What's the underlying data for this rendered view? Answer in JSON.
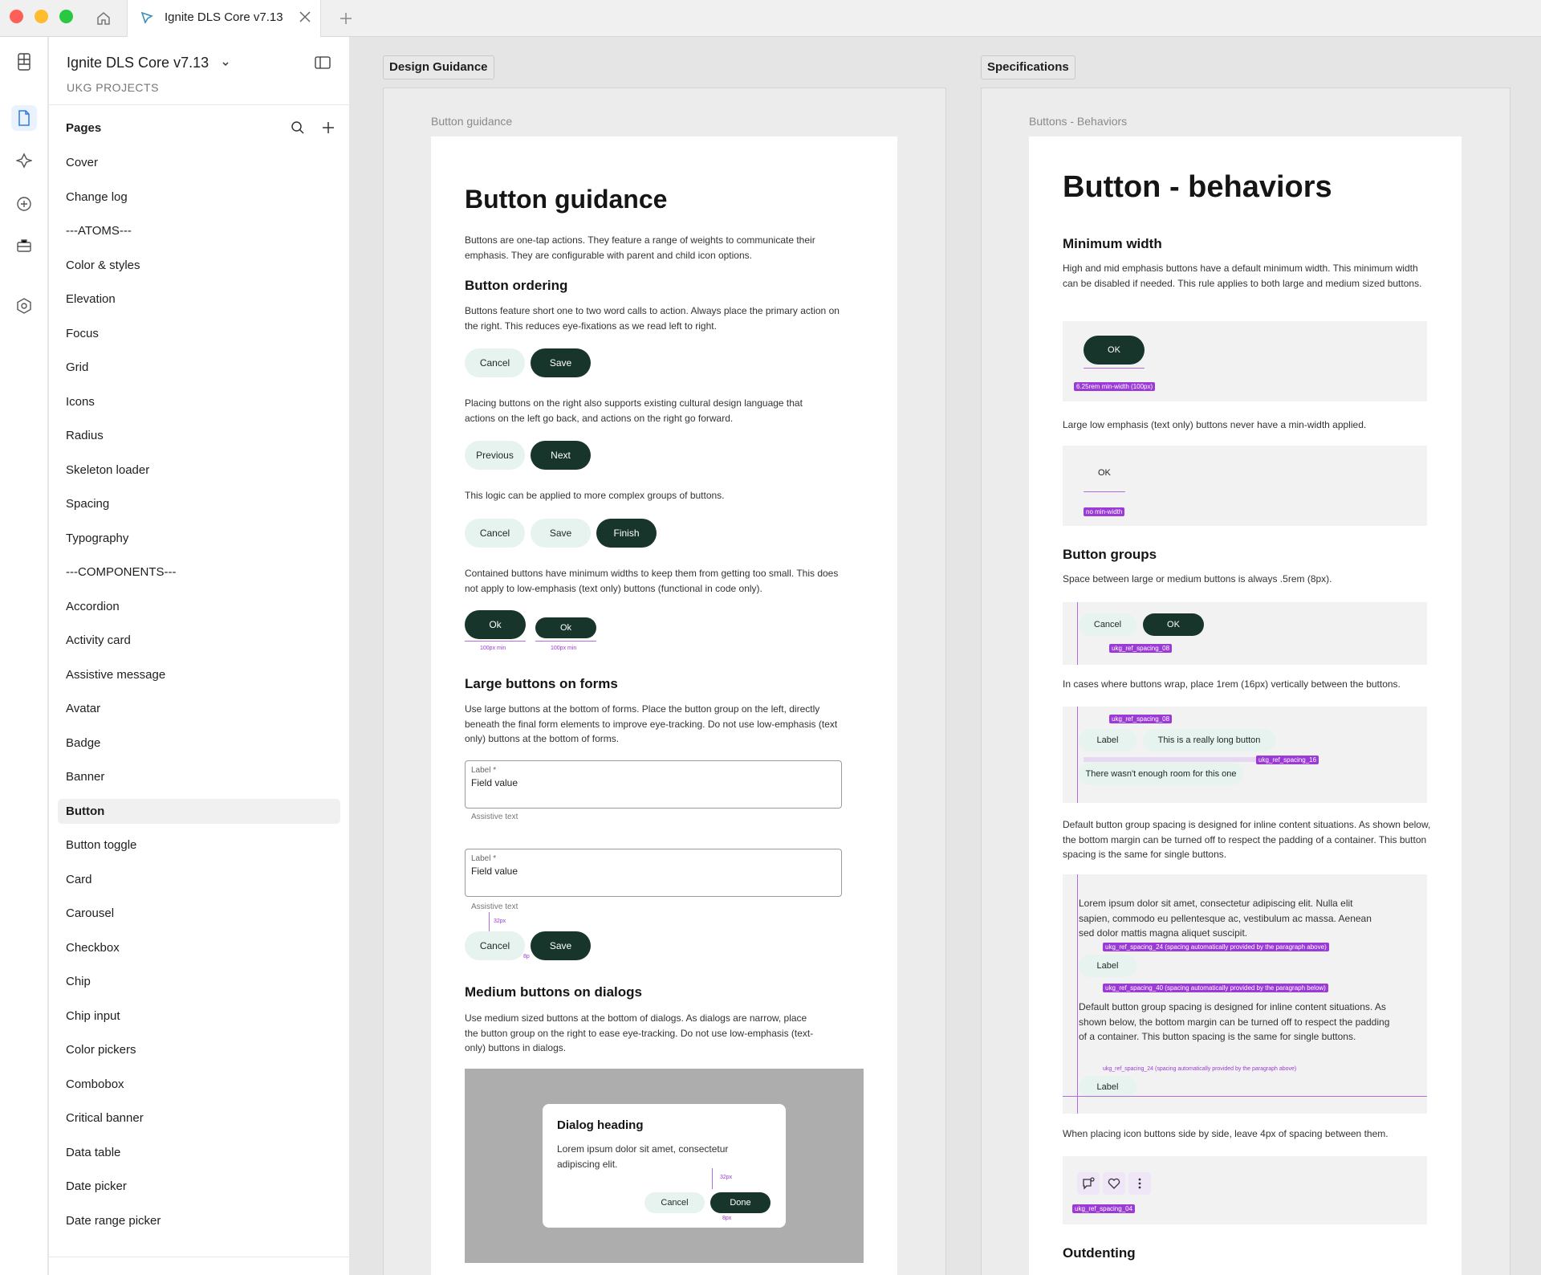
{
  "tabbar": {
    "file_tab_title": "Ignite DLS Core v7.13"
  },
  "colors": {
    "accent": "#17352b",
    "low_emphasis": "#e6f3ef",
    "annotation": "#9b3ad6"
  },
  "panel": {
    "file_title": "Ignite DLS Core v7.13",
    "team": "UKG PROJECTS",
    "pages_heading": "Pages",
    "pages": [
      "Cover",
      "Change log",
      "---ATOMS---",
      "Color & styles",
      "Elevation",
      "Focus",
      "Grid",
      "Icons",
      "Radius",
      "Skeleton loader",
      "Spacing",
      "Typography",
      "---COMPONENTS---",
      "Accordion",
      "Activity card",
      "Assistive message",
      "Avatar",
      "Badge",
      "Banner",
      "Button",
      "Button toggle",
      "Card",
      "Carousel",
      "Checkbox",
      "Chip",
      "Chip input",
      "Color pickers",
      "Combobox",
      "Critical banner",
      "Data table",
      "Date picker",
      "Date range picker"
    ],
    "selected_page": "Button"
  },
  "sections": {
    "design_guidance": "Design Guidance",
    "specifications": "Specifications"
  },
  "guidance": {
    "frame_label": "Button guidance",
    "title": "Button guidance",
    "intro": "Buttons are one-tap actions. They feature a range of weights to communicate their emphasis. They are configurable with parent and child icon options.",
    "ordering_heading": "Button ordering",
    "ordering_text": "Buttons feature short one to two word calls to action. Always place the primary action on the right. This reduces eye-fixations as we read left to right.",
    "cancel": "Cancel",
    "save": "Save",
    "placing_text": "Placing buttons on the right also supports existing cultural design language that actions on the left go back, and actions on the right go forward.",
    "previous": "Previous",
    "next": "Next",
    "logic_text": "This logic can be applied to more complex groups of buttons.",
    "finish": "Finish",
    "contained_text": "Contained buttons have minimum widths to keep them from getting too small. This does not apply to low-emphasis (text only) buttons (functional in code only).",
    "ok": "Ok",
    "min_label": "100px min",
    "large_heading": "Large buttons on forms",
    "large_text": "Use large buttons at the bottom of forms. Place the button group on the left, directly beneath the final form elements to improve eye-tracking. Do not use low-emphasis (text only) buttons at the bottom of forms.",
    "field_label": "Label *",
    "field_value": "Field value",
    "assistive": "Assistive text",
    "spacing_32": "32px",
    "spacing_8": "8p",
    "medium_heading": "Medium buttons on dialogs",
    "medium_text": "Use medium sized buttons at the bottom of dialogs. As dialogs are narrow, place the button group on the right to ease eye-tracking. Do not use low-emphasis (text-only) buttons in dialogs.",
    "dialog_heading": "Dialog heading",
    "dialog_body": "Lorem ipsum dolor sit amet, consectetur adipiscing elit.",
    "done": "Done",
    "dialog_32": "32px",
    "dialog_8": "8px"
  },
  "behaviors": {
    "frame_label": "Buttons - Behaviors",
    "title": "Button - behaviors",
    "minwidth_heading": "Minimum width",
    "minwidth_text": "High and mid emphasis buttons have a default minimum width. This minimum width can be disabled if needed. This rule applies to both large and medium sized buttons.",
    "ok": "OK",
    "minwidth_tag": "6.25rem min-width (100px)",
    "low_text": "Large low emphasis (text only) buttons never have a min-width applied.",
    "no_min_tag": "no min-width",
    "groups_heading": "Button groups",
    "groups_text": "Space between large or medium buttons is always .5rem (8px).",
    "cancel": "Cancel",
    "spacing_08": "ukg_ref_spacing_08",
    "wrap_text": "In cases where buttons wrap, place 1rem (16px) vertically between the buttons.",
    "label": "Label",
    "long_button": "This is a really long button",
    "spacing_16": "ukg_ref_spacing_16",
    "no_room": "There wasn't enough room for this one",
    "default_text": "Default button group spacing is designed for inline content situations. As shown below, the bottom margin can be turned off to respect the padding of a container. This button spacing is the same for single buttons.",
    "lorem": "Lorem ipsum dolor sit amet, consectetur adipiscing elit. Nulla elit sapien, commodo eu pellentesque ac, vestibulum ac massa. Aenean sed dolor mattis magna aliquet suscipit.",
    "spacing_24_above": "ukg_ref_spacing_24 (spacing automatically provided by the paragraph above)",
    "spacing_40_below": "ukg_ref_spacing_40 (spacing automatically provided by the paragraph below)",
    "default_text2": "Default button group spacing is designed for inline content situations. As shown below, the bottom margin can be turned off to respect the padding of a container. This button spacing is the same for single buttons.",
    "spacing_24_above2": "ukg_ref_spacing_24 (spacing automatically provided by the paragraph above)",
    "icon_text": "When placing icon buttons side by side, leave 4px of spacing between them.",
    "spacing_04": "ukg_ref_spacing_04",
    "outdenting_heading": "Outdenting"
  }
}
